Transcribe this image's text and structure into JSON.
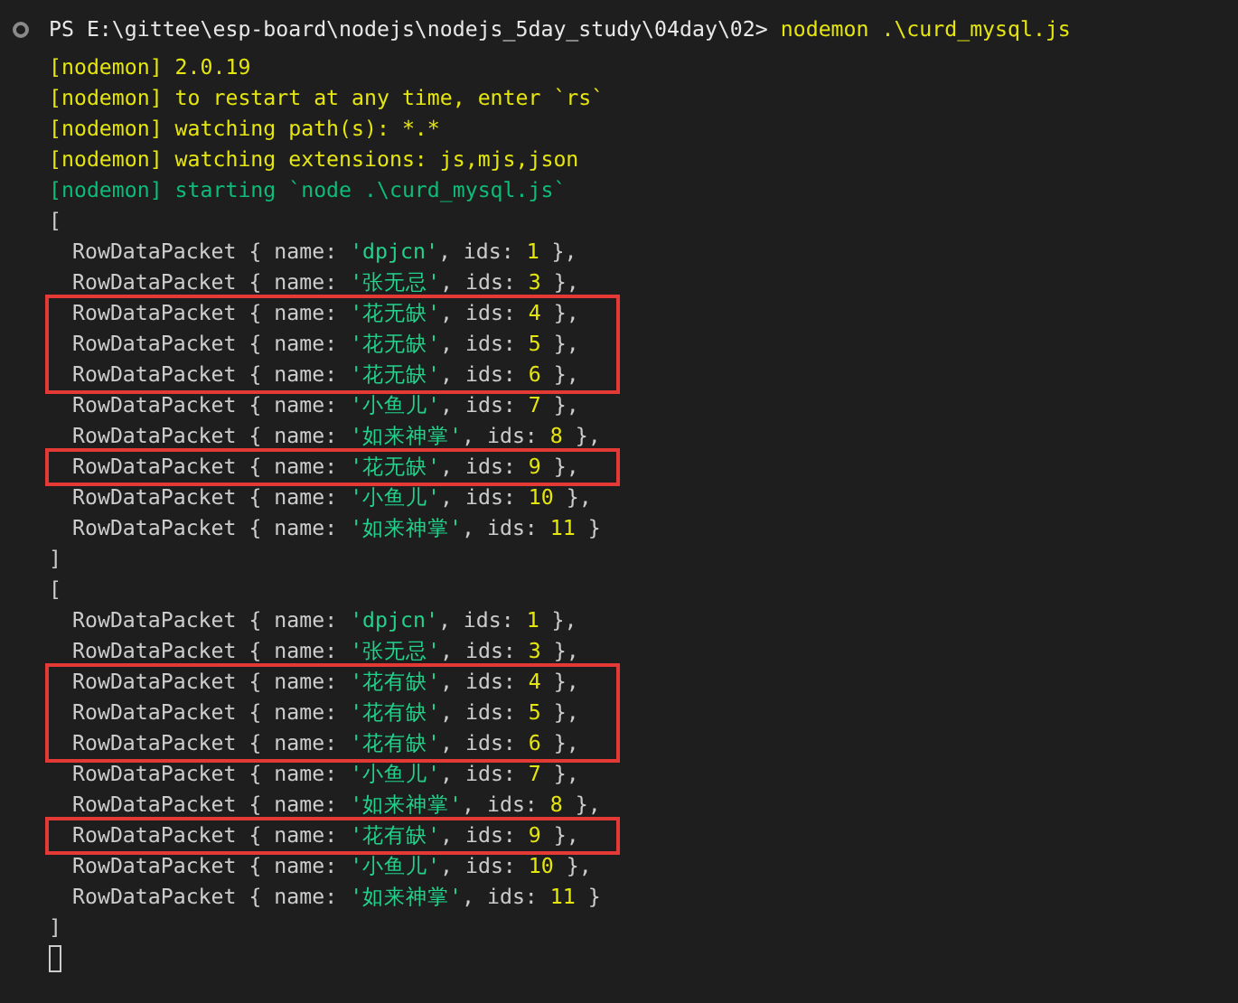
{
  "prompt": {
    "path": "PS E:\\gittee\\esp-board\\nodejs\\nodejs_5day_study\\04day\\02>",
    "command": "nodemon .\\curd_mysql.js"
  },
  "log_lines": [
    {
      "text": "[nodemon] 2.0.19",
      "kind": "warn"
    },
    {
      "text": "[nodemon] to restart at any time, enter `rs`",
      "kind": "warn"
    },
    {
      "text": "[nodemon] watching path(s): *.*",
      "kind": "warn"
    },
    {
      "text": "[nodemon] watching extensions: js,mjs,json",
      "kind": "warn"
    },
    {
      "text": "[nodemon] starting `node .\\curd_mysql.js`",
      "kind": "info"
    }
  ],
  "outputs": [
    {
      "open": "[",
      "close": "]",
      "segments": [
        {
          "highlighted": false,
          "rows": [
            {
              "prefix": "RowDataPacket { name: ",
              "name": "'dpjcn'",
              "mid": ", ids: ",
              "ids": "1",
              "suffix": " },"
            },
            {
              "prefix": "RowDataPacket { name: ",
              "name": "'张无忌'",
              "mid": ", ids: ",
              "ids": "3",
              "suffix": " },"
            }
          ]
        },
        {
          "highlighted": true,
          "rows": [
            {
              "prefix": "RowDataPacket { name: ",
              "name": "'花无缺'",
              "mid": ", ids: ",
              "ids": "4",
              "suffix": " },"
            },
            {
              "prefix": "RowDataPacket { name: ",
              "name": "'花无缺'",
              "mid": ", ids: ",
              "ids": "5",
              "suffix": " },"
            },
            {
              "prefix": "RowDataPacket { name: ",
              "name": "'花无缺'",
              "mid": ", ids: ",
              "ids": "6",
              "suffix": " },"
            }
          ]
        },
        {
          "highlighted": false,
          "rows": [
            {
              "prefix": "RowDataPacket { name: ",
              "name": "'小鱼儿'",
              "mid": ", ids: ",
              "ids": "7",
              "suffix": " },"
            },
            {
              "prefix": "RowDataPacket { name: ",
              "name": "'如来神掌'",
              "mid": ", ids: ",
              "ids": "8",
              "suffix": " },"
            }
          ]
        },
        {
          "highlighted": true,
          "rows": [
            {
              "prefix": "RowDataPacket { name: ",
              "name": "'花无缺'",
              "mid": ", ids: ",
              "ids": "9",
              "suffix": " },"
            }
          ]
        },
        {
          "highlighted": false,
          "rows": [
            {
              "prefix": "RowDataPacket { name: ",
              "name": "'小鱼儿'",
              "mid": ", ids: ",
              "ids": "10",
              "suffix": " },"
            },
            {
              "prefix": "RowDataPacket { name: ",
              "name": "'如来神掌'",
              "mid": ", ids: ",
              "ids": "11",
              "suffix": " }"
            }
          ]
        }
      ]
    },
    {
      "open": "[",
      "close": "]",
      "segments": [
        {
          "highlighted": false,
          "rows": [
            {
              "prefix": "RowDataPacket { name: ",
              "name": "'dpjcn'",
              "mid": ", ids: ",
              "ids": "1",
              "suffix": " },"
            },
            {
              "prefix": "RowDataPacket { name: ",
              "name": "'张无忌'",
              "mid": ", ids: ",
              "ids": "3",
              "suffix": " },"
            }
          ]
        },
        {
          "highlighted": true,
          "rows": [
            {
              "prefix": "RowDataPacket { name: ",
              "name": "'花有缺'",
              "mid": ", ids: ",
              "ids": "4",
              "suffix": " },"
            },
            {
              "prefix": "RowDataPacket { name: ",
              "name": "'花有缺'",
              "mid": ", ids: ",
              "ids": "5",
              "suffix": " },"
            },
            {
              "prefix": "RowDataPacket { name: ",
              "name": "'花有缺'",
              "mid": ", ids: ",
              "ids": "6",
              "suffix": " },"
            }
          ]
        },
        {
          "highlighted": false,
          "rows": [
            {
              "prefix": "RowDataPacket { name: ",
              "name": "'小鱼儿'",
              "mid": ", ids: ",
              "ids": "7",
              "suffix": " },"
            },
            {
              "prefix": "RowDataPacket { name: ",
              "name": "'如来神掌'",
              "mid": ", ids: ",
              "ids": "8",
              "suffix": " },"
            }
          ]
        },
        {
          "highlighted": true,
          "rows": [
            {
              "prefix": "RowDataPacket { name: ",
              "name": "'花有缺'",
              "mid": ", ids: ",
              "ids": "9",
              "suffix": " },"
            }
          ]
        },
        {
          "highlighted": false,
          "rows": [
            {
              "prefix": "RowDataPacket { name: ",
              "name": "'小鱼儿'",
              "mid": ", ids: ",
              "ids": "10",
              "suffix": " },"
            },
            {
              "prefix": "RowDataPacket { name: ",
              "name": "'如来神掌'",
              "mid": ", ids: ",
              "ids": "11",
              "suffix": " }"
            }
          ]
        }
      ]
    }
  ]
}
